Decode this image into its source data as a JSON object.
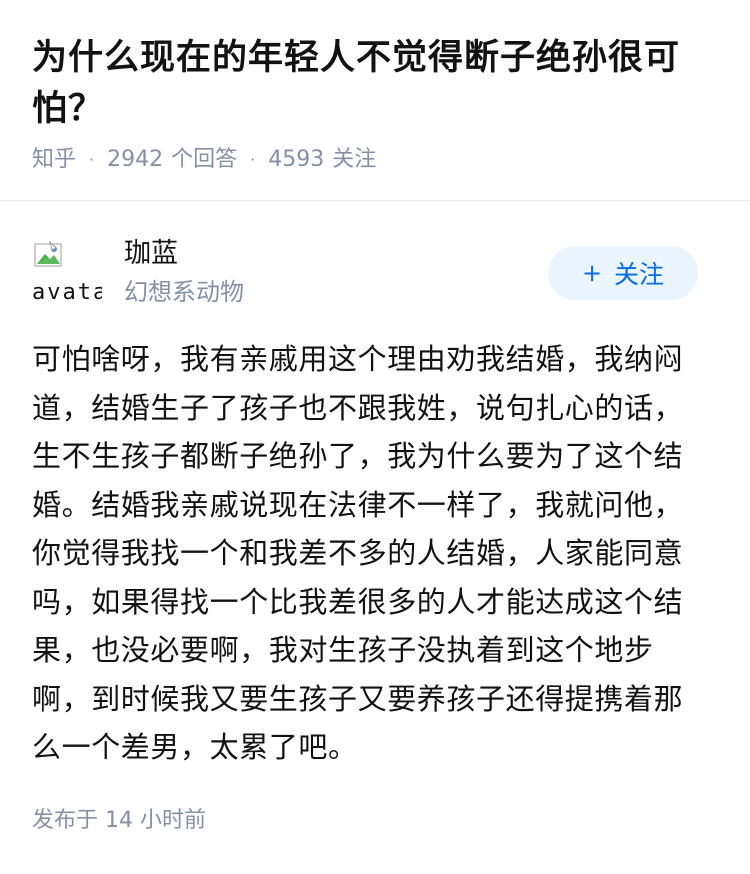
{
  "question": {
    "title": "为什么现在的年轻人不觉得断子绝孙很可怕？",
    "source": "知乎",
    "answer_count": "2942",
    "answer_label": "个回答",
    "follower_count": "4593",
    "follower_label": "关注"
  },
  "author": {
    "avatar_alt": "avatar",
    "name": "珈蓝",
    "bio": "幻想系动物",
    "follow_icon": "+",
    "follow_label": "关注"
  },
  "answer": {
    "content": "可怕啥呀，我有亲戚用这个理由劝我结婚，我纳闷道，结婚生子了孩子也不跟我姓，说句扎心的话，生不生孩子都断子绝孙了，我为什么要为了这个结婚。结婚我亲戚说现在法律不一样了，我就问他，你觉得我找一个和我差不多的人结婚，人家能同意吗，如果得找一个比我差很多的人才能达成这个结果，也没必要啊，我对生孩子没执着到这个地步啊，到时候我又要生孩子又要养孩子还得提携着那么一个差男，太累了吧。",
    "published": "发布于  14 小时前"
  },
  "colors": {
    "text": "#121212",
    "meta": "#8590a6",
    "accent": "#056de8",
    "accent_bg": "#ebf5ff"
  }
}
